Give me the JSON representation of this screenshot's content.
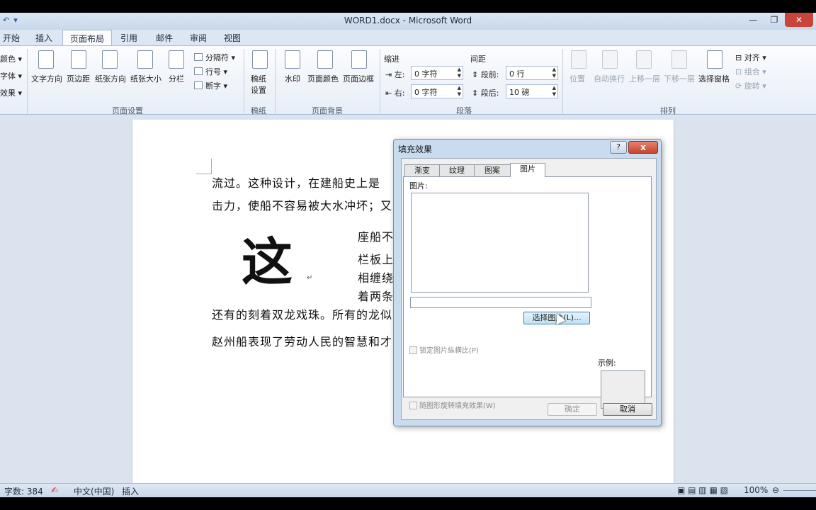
{
  "window": {
    "title": "WORD1.docx - Microsoft Word"
  },
  "tabs": [
    "开始",
    "插入",
    "页面布局",
    "引用",
    "邮件",
    "审阅",
    "视图"
  ],
  "ribbon": {
    "theme_items": [
      "颜色",
      "字体",
      "效果"
    ],
    "page_setup": {
      "buttons": [
        "文字方向",
        "页边距",
        "纸张方向",
        "纸张大小",
        "分栏"
      ],
      "small": [
        "分隔符",
        "行号",
        "断字"
      ],
      "label": "页面设置"
    },
    "manuscript": {
      "button_line1": "稿纸",
      "button_line2": "设置",
      "label": "稿纸"
    },
    "page_background": {
      "buttons": [
        "水印",
        "页面颜色",
        "页面边框"
      ],
      "label": "页面背景"
    },
    "paragraph": {
      "indent_title": "缩进",
      "indent_left_label": "左:",
      "indent_left_value": "0 字符",
      "indent_right_label": "右:",
      "indent_right_value": "0 字符",
      "spacing_title": "间距",
      "spacing_before_label": "段前:",
      "spacing_before_value": "0 行",
      "spacing_after_label": "段后:",
      "spacing_after_value": "10 磅",
      "label": "段落"
    },
    "arrange": {
      "buttons": [
        "位置",
        "自动换行",
        "上移一层",
        "下移一层",
        "选择窗格"
      ],
      "small": [
        "对齐",
        "组合",
        "旋转"
      ],
      "label": "排列"
    }
  },
  "document": {
    "line1": "流过。这种设计，在建船史上是",
    "line2": "击力，使船不容易被大水冲坏；又",
    "big_char": "这",
    "side_lines": [
      "座船不",
      "栏板上",
      "相缠绕",
      "着两条"
    ],
    "line3": "还有的刻着双龙戏珠。所有的龙似",
    "line4": "赵州船表现了劳动人民的智慧和才"
  },
  "dialog": {
    "title": "填充效果",
    "help": "?",
    "close": "x",
    "tabs": [
      "渐变",
      "纹理",
      "图案",
      "图片"
    ],
    "active_tab": "图片",
    "picture_label": "图片:",
    "select_button": "选择图片(L)...",
    "lock_aspect": "锁定图片纵横比(P)",
    "rotate_with_shape": "随图形旋转填充效果(W)",
    "sample_label": "示例:",
    "ok": "确定",
    "cancel": "取消"
  },
  "statusbar": {
    "word_count": "字数: 384",
    "language": "中文(中国)",
    "mode": "插入",
    "zoom": "100%"
  }
}
